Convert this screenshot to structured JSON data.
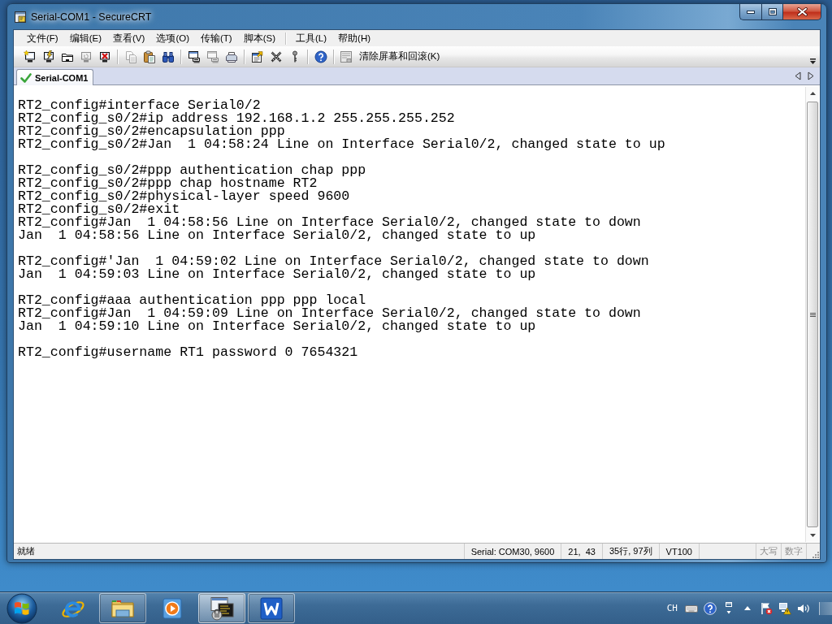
{
  "window": {
    "title": "Serial-COM1 - SecureCRT"
  },
  "menu_groups": [
    {
      "items": [
        "文件(F)",
        "编辑(E)",
        "查看(V)",
        "选项(O)",
        "传输(T)",
        "脚本(S)"
      ]
    },
    {
      "items": [
        "工具(L)",
        "帮助(H)"
      ]
    }
  ],
  "toolbar": {
    "groups": [
      {
        "buttons": [
          {
            "disabled": false
          },
          {
            "disabled": false
          },
          {
            "disabled": false
          },
          {
            "disabled": true
          },
          {
            "disabled": false
          }
        ]
      },
      {
        "buttons": [
          {
            "disabled": true
          },
          {
            "disabled": false
          },
          {
            "disabled": false
          }
        ]
      },
      {
        "buttons": [
          {
            "disabled": false
          },
          {
            "disabled": true
          },
          {
            "disabled": false
          }
        ]
      },
      {
        "buttons": [
          {
            "disabled": false
          },
          {
            "disabled": false
          },
          {
            "disabled": false
          }
        ]
      },
      {
        "buttons": [
          {
            "disabled": false
          }
        ]
      }
    ],
    "clear_button": {
      "label": "清除屏幕和回滚(K)"
    }
  },
  "tabs": [
    {
      "label": "Serial-COM1",
      "selected": true,
      "connected": true
    }
  ],
  "terminal": {
    "blocks": [
      {
        "lines": [
          "RT2_config#interface Serial0/2",
          "RT2_config_s0/2#ip address 192.168.1.2 255.255.255.252",
          "RT2_config_s0/2#encapsulation ppp",
          "RT2_config_s0/2#Jan  1 04:58:24 Line on Interface Serial0/2, changed state to up"
        ]
      },
      {
        "lines": [
          "RT2_config_s0/2#ppp authentication chap ppp",
          "RT2_config_s0/2#ppp chap hostname RT2",
          "RT2_config_s0/2#physical-layer speed 9600",
          "RT2_config_s0/2#exit",
          "RT2_config#Jan  1 04:58:56 Line on Interface Serial0/2, changed state to down",
          "Jan  1 04:58:56 Line on Interface Serial0/2, changed state to up"
        ]
      },
      {
        "lines": [
          "RT2_config#'Jan  1 04:59:02 Line on Interface Serial0/2, changed state to down",
          "Jan  1 04:59:03 Line on Interface Serial0/2, changed state to up"
        ]
      },
      {
        "lines": [
          "RT2_config#aaa authentication ppp ppp local",
          "RT2_config#Jan  1 04:59:09 Line on Interface Serial0/2, changed state to down",
          "Jan  1 04:59:10 Line on Interface Serial0/2, changed state to up"
        ]
      },
      {
        "lines": [
          "RT2_config#username RT1 password 0 7654321"
        ]
      }
    ]
  },
  "status_bar": {
    "message": "就绪",
    "panels": [
      "Serial: COM30, 9600",
      "21,  43",
      "35行, 97列",
      "VT100"
    ],
    "indicators": [
      {
        "label": "大写",
        "on": false
      },
      {
        "label": "数字",
        "on": false
      }
    ]
  },
  "taskbar": {
    "apps": [
      {
        "running": false,
        "selected": false
      },
      {
        "running": true,
        "selected": false
      },
      {
        "running": false,
        "selected": false
      },
      {
        "running": true,
        "selected": true
      },
      {
        "running": true,
        "selected": false
      }
    ],
    "tray": {
      "language": "CH"
    }
  }
}
